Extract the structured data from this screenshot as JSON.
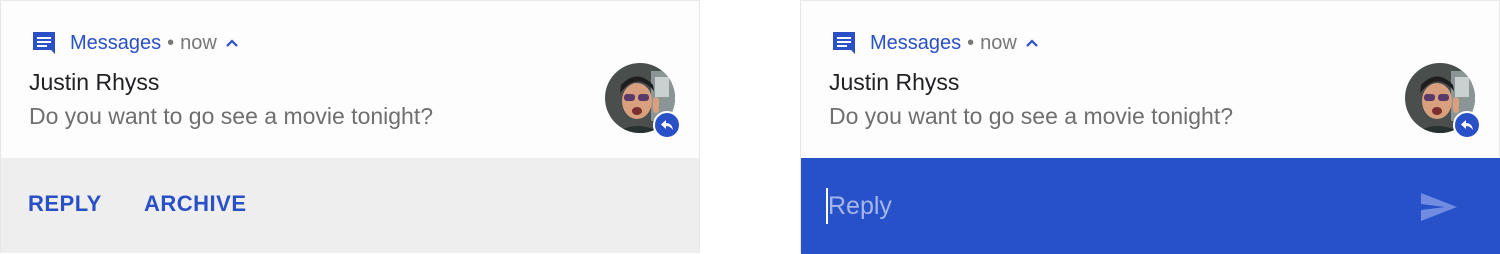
{
  "notification_collapsed": {
    "app_name": "Messages",
    "separator": "•",
    "time": "now",
    "sender": "Justin Rhyss",
    "message": "Do you want to go see a movie tonight?",
    "actions": {
      "reply_label": "REPLY",
      "archive_label": "ARCHIVE"
    }
  },
  "notification_reply": {
    "app_name": "Messages",
    "separator": "•",
    "time": "now",
    "sender": "Justin Rhyss",
    "message": "Do you want to go see a movie tonight?",
    "reply_input": {
      "placeholder": "Reply",
      "value": ""
    }
  },
  "icons": {
    "app": "messages-icon",
    "expand": "chevron-up-icon",
    "badge": "reply-arrow-icon",
    "send": "send-icon"
  },
  "colors": {
    "accent": "#2a50c8",
    "reply_bar": "#2651c9",
    "actions_bg": "#eeeeee"
  }
}
